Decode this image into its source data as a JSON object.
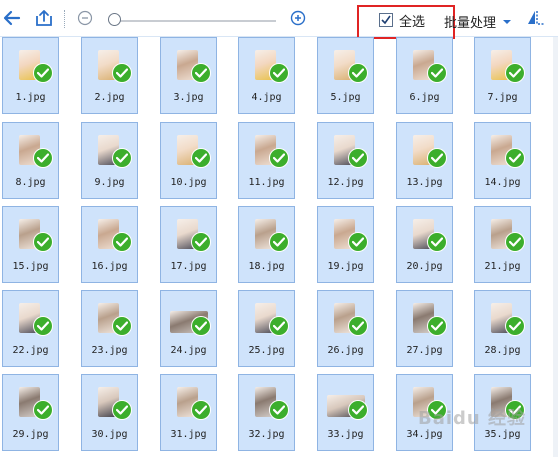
{
  "toolbar": {
    "select_all_label": "全选",
    "batch_label": "批量处理",
    "select_all_checked": true,
    "zoom_level": 0.0,
    "icons": [
      "back-arrow-icon",
      "export-icon",
      "zoom-out-icon",
      "zoom-in-icon",
      "chevron-down-icon",
      "rotate-icon"
    ]
  },
  "colors": {
    "tile_bg": "#cfe3fb",
    "tile_border": "#8fb4e3",
    "check_green": "#3cae2c",
    "accent_blue": "#2a6fc9",
    "highlight_red": "#e02424"
  },
  "files": [
    {
      "name": "1.jpg"
    },
    {
      "name": "2.jpg"
    },
    {
      "name": "3.jpg"
    },
    {
      "name": "4.jpg"
    },
    {
      "name": "5.jpg"
    },
    {
      "name": "6.jpg"
    },
    {
      "name": "7.jpg"
    },
    {
      "name": "8.jpg"
    },
    {
      "name": "9.jpg"
    },
    {
      "name": "10.jpg"
    },
    {
      "name": "11.jpg"
    },
    {
      "name": "12.jpg"
    },
    {
      "name": "13.jpg"
    },
    {
      "name": "14.jpg"
    },
    {
      "name": "15.jpg"
    },
    {
      "name": "16.jpg"
    },
    {
      "name": "17.jpg"
    },
    {
      "name": "18.jpg"
    },
    {
      "name": "19.jpg"
    },
    {
      "name": "20.jpg"
    },
    {
      "name": "21.jpg"
    },
    {
      "name": "22.jpg"
    },
    {
      "name": "23.jpg"
    },
    {
      "name": "24.jpg"
    },
    {
      "name": "25.jpg"
    },
    {
      "name": "26.jpg"
    },
    {
      "name": "27.jpg"
    },
    {
      "name": "28.jpg"
    },
    {
      "name": "29.jpg"
    },
    {
      "name": "30.jpg"
    },
    {
      "name": "31.jpg"
    },
    {
      "name": "32.jpg"
    },
    {
      "name": "33.jpg"
    },
    {
      "name": "34.jpg"
    },
    {
      "name": "35.jpg"
    }
  ],
  "watermark": "Baidu 经验"
}
